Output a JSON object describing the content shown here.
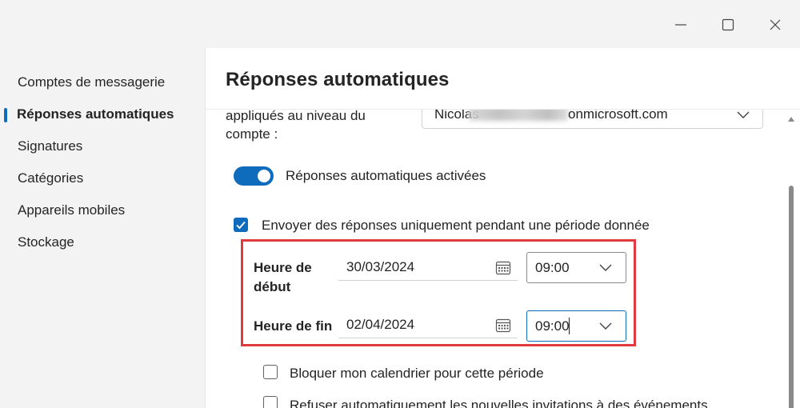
{
  "window": {
    "controls": [
      "minimize-icon",
      "maximize-icon",
      "close-icon"
    ]
  },
  "sidebar": {
    "items": [
      {
        "label": "Comptes de messagerie"
      },
      {
        "label": "Réponses automatiques",
        "active": true
      },
      {
        "label": "Signatures"
      },
      {
        "label": "Catégories"
      },
      {
        "label": "Appareils mobiles"
      },
      {
        "label": "Stockage"
      }
    ]
  },
  "main": {
    "title": "Réponses automatiques",
    "account_label_line1": "appliqués au niveau du",
    "account_label_line2": "compte :",
    "account_prefix": "Nicolas",
    "account_suffix": "onmicrosoft.com",
    "toggle_label": "Réponses automatiques activées",
    "toggle_on": true,
    "period_checkbox_label": "Envoyer des réponses uniquement pendant une période donnée",
    "period_checked": true,
    "start_label_line1": "Heure de",
    "start_label_line2": "début",
    "start_date": "30/03/2024",
    "start_time": "09:00",
    "end_label": "Heure de fin",
    "end_date": "02/04/2024",
    "end_time": "09:00",
    "block_calendar_label": "Bloquer mon calendrier pour cette période",
    "decline_invites_label": "Refuser automatiquement les nouvelles invitations à des événements"
  },
  "colors": {
    "accent": "#0f6cbd",
    "highlight_frame": "#e03a3e",
    "sidebar_bg": "#f3f3f3",
    "content_bg": "#ffffff"
  }
}
